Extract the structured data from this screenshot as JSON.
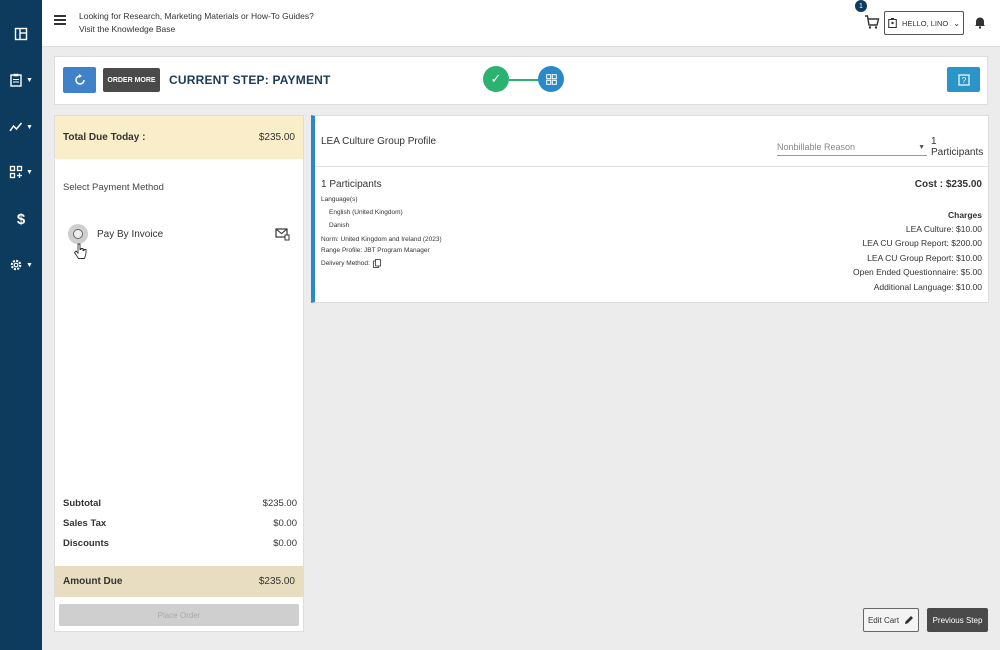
{
  "sidebar": {
    "items": [
      {
        "icon": "layout-icon",
        "caret": false
      },
      {
        "icon": "clipboard-icon",
        "caret": true
      },
      {
        "icon": "analytics-icon",
        "caret": true
      },
      {
        "icon": "grid-add-icon",
        "caret": true
      },
      {
        "icon": "dollar-icon",
        "caret": false,
        "glyph": "$"
      },
      {
        "icon": "gear-icon",
        "caret": true
      }
    ]
  },
  "topbar": {
    "kb_line1": "Looking for Research, Marketing Materials or How-To Guides?",
    "kb_line2": "Visit the Knowledge Base",
    "cart_count": "1",
    "hello_label": "HELLO, LINO"
  },
  "stepbar": {
    "order_more": "ORDER MORE",
    "current_step": "CURRENT STEP:  PAYMENT"
  },
  "payment": {
    "total_due_label": "Total Due Today :",
    "total_due_value": "$235.00",
    "select_method": "Select Payment Method",
    "pay_by_invoice": "Pay By Invoice",
    "subtotal_label": "Subtotal",
    "subtotal_value": "$235.00",
    "tax_label": "Sales Tax",
    "tax_value": "$0.00",
    "discounts_label": "Discounts",
    "discounts_value": "$0.00",
    "amount_due_label": "Amount Due",
    "amount_due_value": "$235.00",
    "place_order": "Place Order"
  },
  "profile": {
    "title": "LEA Culture Group Profile",
    "nonbillable_placeholder": "Nonbillable Reason",
    "participants_top": "1 Participants",
    "participants": "1 Participants",
    "languages_label": "Language(s)",
    "languages": [
      "English (United Kingdom)",
      "Danish"
    ],
    "norm": "Norm: United Kingdom and Ireland (2023)",
    "range_profile": "Range Profile: JBT Program Manager",
    "delivery_method": "Delivery Method:",
    "cost": "Cost : $235.00",
    "charges_label": "Charges",
    "charges": [
      "LEA Culture: $10.00",
      "LEA CU Group Report: $200.00",
      "LEA CU Group Report: $10.00",
      "Open Ended Questionnaire: $5.00",
      "Additional Language: $10.00"
    ]
  },
  "footer": {
    "edit_cart": "Edit Cart",
    "previous_step": "Previous Step"
  },
  "colors": {
    "sidebar": "#0d3b5e",
    "accent": "#2a89c9",
    "success": "#2cb270",
    "highlight": "#faedc9"
  }
}
